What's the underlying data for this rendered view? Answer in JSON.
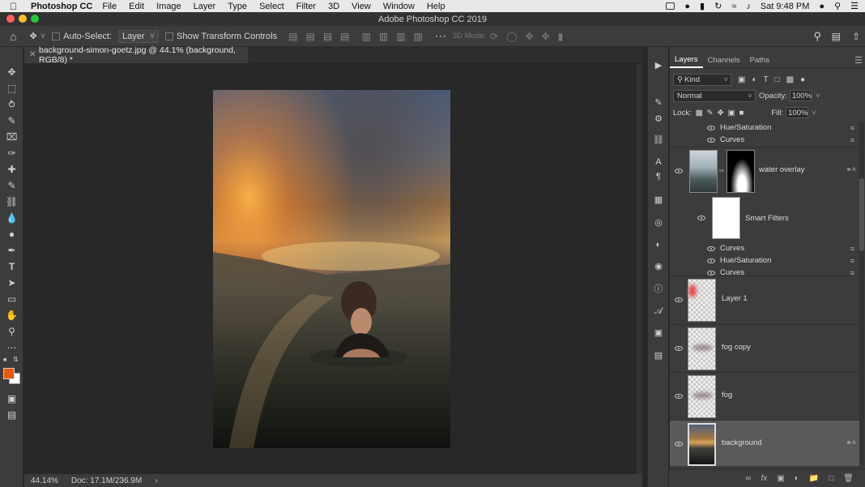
{
  "menubar": {
    "app_name": "Photoshop CC",
    "items": [
      "File",
      "Edit",
      "Image",
      "Layer",
      "Type",
      "Select",
      "Filter",
      "3D",
      "View",
      "Window",
      "Help"
    ],
    "clock": "Sat 9:48 PM"
  },
  "window": {
    "title": "Adobe Photoshop CC 2019"
  },
  "options_bar": {
    "auto_select_label": "Auto-Select:",
    "auto_select_value": "Layer",
    "show_transform_label": "Show Transform Controls",
    "mode_label": "3D Mode:"
  },
  "document": {
    "tab_label": "background-simon-goetz.jpg @ 44.1% (background, RGB/8) *",
    "zoom": "44.14%",
    "doc_size": "Doc: 17.1M/236.9M"
  },
  "layers_panel": {
    "tabs": [
      "Layers",
      "Channels",
      "Paths"
    ],
    "filter_kind": "Kind",
    "blend_mode": "Normal",
    "opacity_label": "Opacity:",
    "opacity_value": "100%",
    "lock_label": "Lock:",
    "fill_label": "Fill:",
    "fill_value": "100%",
    "effects_top": [
      "Hue/Saturation",
      "Curves"
    ],
    "water_overlay": "water overlay",
    "smart_filters": "Smart Filters",
    "effects_filters": [
      "Curves",
      "Hue/Saturation",
      "Curves"
    ],
    "layers": [
      "Layer 1",
      "fog copy",
      "fog",
      "background"
    ]
  },
  "colors": {
    "foreground": "#e8590c",
    "background": "#ffffff",
    "panel": "#3c3c3c",
    "canvas": "#282828"
  }
}
